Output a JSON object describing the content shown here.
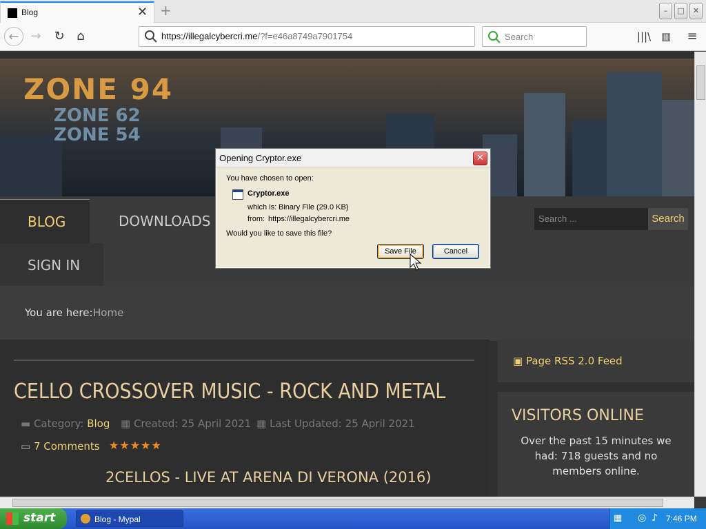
{
  "browser": {
    "tab_title": "Blog",
    "url_host": "https://illegalcybercri.me",
    "url_path": "/?f=e46a8749a7901754",
    "search_placeholder": "Search"
  },
  "site": {
    "logo_line1": "ZONE 94",
    "logo_line2": "ZONE 62",
    "logo_line3": "ZONE 54",
    "menu": [
      "BLOG",
      "DOWNLOADS",
      "SIGN IN"
    ],
    "search_placeholder": "Search ...",
    "search_button": "Search",
    "breadcrumb_label": "You are here:",
    "breadcrumb_home": "Home",
    "article": {
      "title": "CELLO CROSSOVER MUSIC - ROCK AND METAL",
      "category_label": "Category:",
      "category_value": "Blog",
      "created": "Created: 25 April 2021",
      "updated": "Last Updated: 25 April 2021",
      "comments": "7 Comments",
      "rating_stars": 5,
      "subtitle": "2CELLOS - LIVE AT ARENA DI VERONA (2016)"
    },
    "rss_feed": "Page RSS 2.0 Feed",
    "visitors_heading": "VISITORS ONLINE",
    "visitors_text": "Over the past 15 minutes we had: 718 guests and no members online."
  },
  "dialog": {
    "title": "Opening Cryptor.exe",
    "intro": "You have chosen to open:",
    "filename": "Cryptor.exe",
    "which_is_label": "which is:",
    "which_is_value": "Binary File (29.0 KB)",
    "from_label": "from:",
    "from_value": "https://illegalcybercri.me",
    "question": "Would you like to save this file?",
    "save_button": "Save File",
    "cancel_button": "Cancel"
  },
  "taskbar": {
    "start": "start",
    "task_item": "Blog - Mypal",
    "clock": "7:46 PM"
  },
  "colors": {
    "accent_gold": "#f0d070",
    "star_orange": "#f08a20",
    "taskbar_blue": "#2455c8",
    "start_green": "#2f8a2f"
  }
}
